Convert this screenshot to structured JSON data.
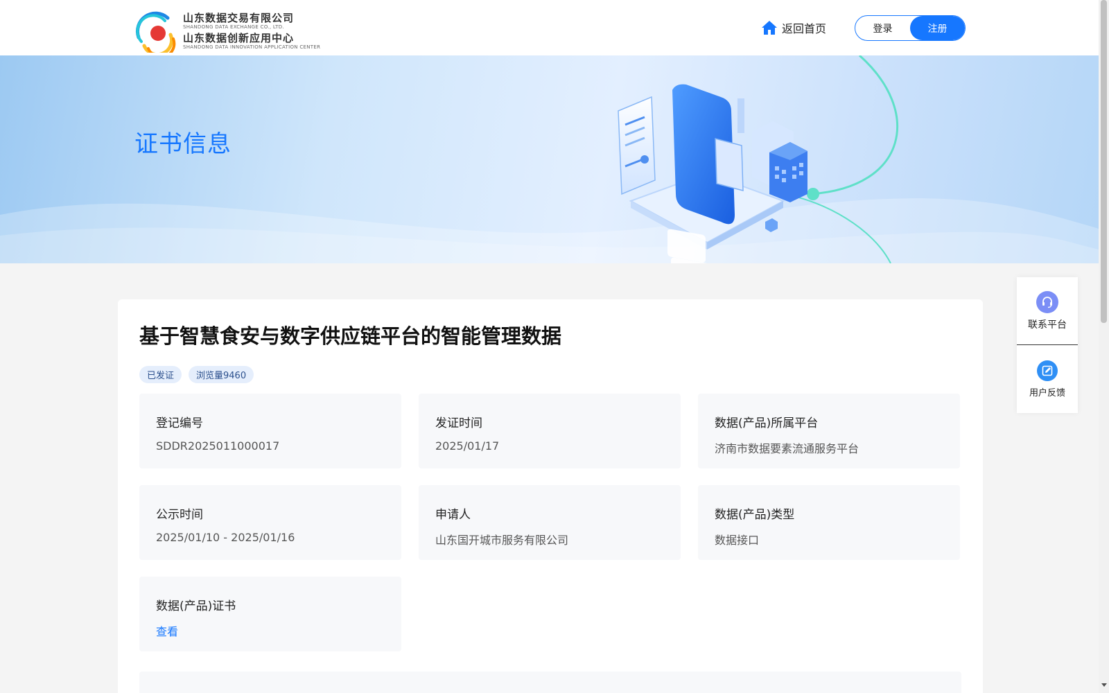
{
  "header": {
    "logo": {
      "company_cn": "山东数据交易有限公司",
      "company_en": "SHANDONG DATA EXCHANGE CO., LTD.",
      "center_cn": "山东数据创新应用中心",
      "center_en": "SHANDONG DATA INNOVATION APPLICATION CENTER"
    },
    "home_link": "返回首页",
    "login": "登录",
    "register": "注册"
  },
  "banner": {
    "title": "证书信息"
  },
  "product": {
    "title": "基于智慧食安与数字供应链平台的智能管理数据",
    "tags": [
      "已发证",
      "浏览量9460"
    ],
    "fields": [
      {
        "label": "登记编号",
        "value": "SDDR2025011000017"
      },
      {
        "label": "发证时间",
        "value": "2025/01/17"
      },
      {
        "label": "数据(产品)所属平台",
        "value": "济南市数据要素流通服务平台"
      },
      {
        "label": "公示时间",
        "value": "2025/01/10 - 2025/01/16"
      },
      {
        "label": "申请人",
        "value": "山东国开城市服务有限公司"
      },
      {
        "label": "数据(产品)类型",
        "value": "数据接口"
      },
      {
        "label": "数据(产品)证书",
        "value": "查看"
      }
    ]
  },
  "side_panel": {
    "contact": "联系平台",
    "feedback": "用户反馈"
  },
  "colors": {
    "brand": "#1677ff",
    "banner_title": "#1677ff",
    "tag_bg": "#e5eefc",
    "field_bg": "#f7f8fa",
    "page_bg": "#f4f4f4"
  },
  "icons": {
    "home": "home-icon",
    "contact": "headset-icon",
    "feedback": "edit-icon"
  }
}
